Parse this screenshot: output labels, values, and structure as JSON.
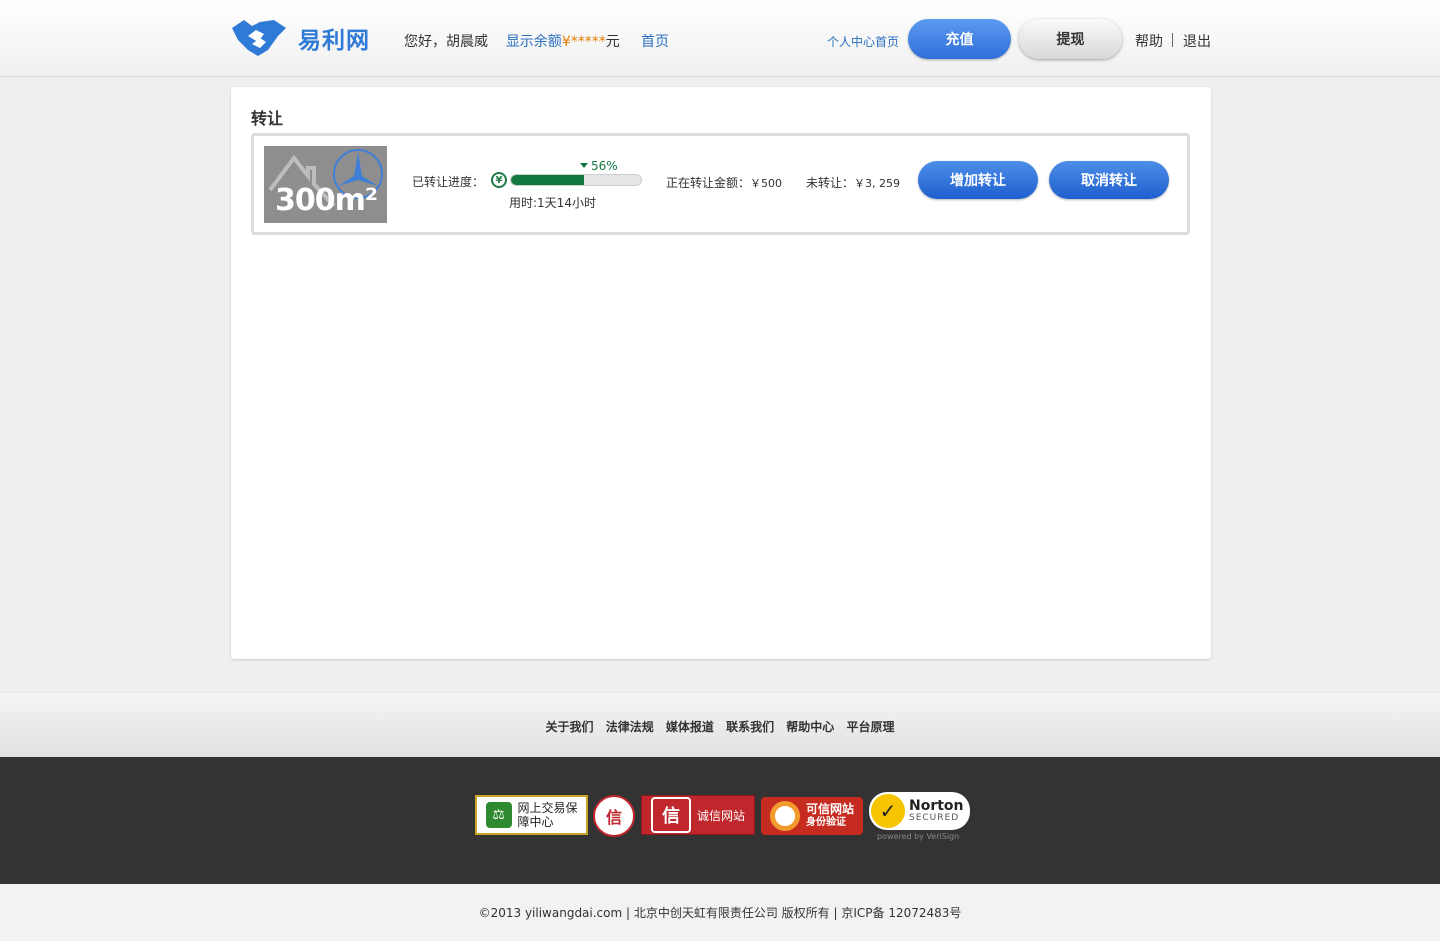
{
  "header": {
    "logo_text": "易利网",
    "greeting": "您好，胡晨威",
    "show_balance": "显示余额",
    "currency_symbol": "¥",
    "balance_mask": "*****",
    "balance_unit": "元",
    "home": "首页",
    "personal_center": "个人中心首页",
    "recharge": "充值",
    "withdraw": "提现",
    "help": "帮助",
    "logout": "退出"
  },
  "panel": {
    "title": "转让",
    "item": {
      "thumb_text": "300m²",
      "progress_label": "已转让进度：",
      "progress_percent_text": "56%",
      "progress_fraction": 0.56,
      "time_used": "用时:1天14小时",
      "transferring_label": "正在转让金额：",
      "transferring_value": "￥500",
      "not_transferred_label": "未转让：",
      "not_transferred_value": "￥3, 259",
      "add_button": "增加转让",
      "cancel_button": "取消转让"
    }
  },
  "footer": {
    "links": [
      "关于我们",
      "法律法规",
      "媒体报道",
      "联系我们",
      "帮助中心",
      "平台原理"
    ],
    "badges": {
      "trade_center": "网上交易保障中心",
      "itrust_char": "信",
      "cx_char": "信",
      "cx_label": "诚信网站",
      "kx_label": "可信网站",
      "kx_sub": "身份验证",
      "norton_title": "Norton",
      "norton_sub": "SECURED",
      "norton_powered": "powered by VeriSign"
    },
    "copyright": "©2013 yiliwangdai.com | 北京中创天虹有限责任公司 版权所有 | 京ICP备 12072483号"
  },
  "colors": {
    "accent_blue": "#2f6ed8",
    "progress_green": "#137a3f",
    "balance_orange": "#e07d00"
  }
}
